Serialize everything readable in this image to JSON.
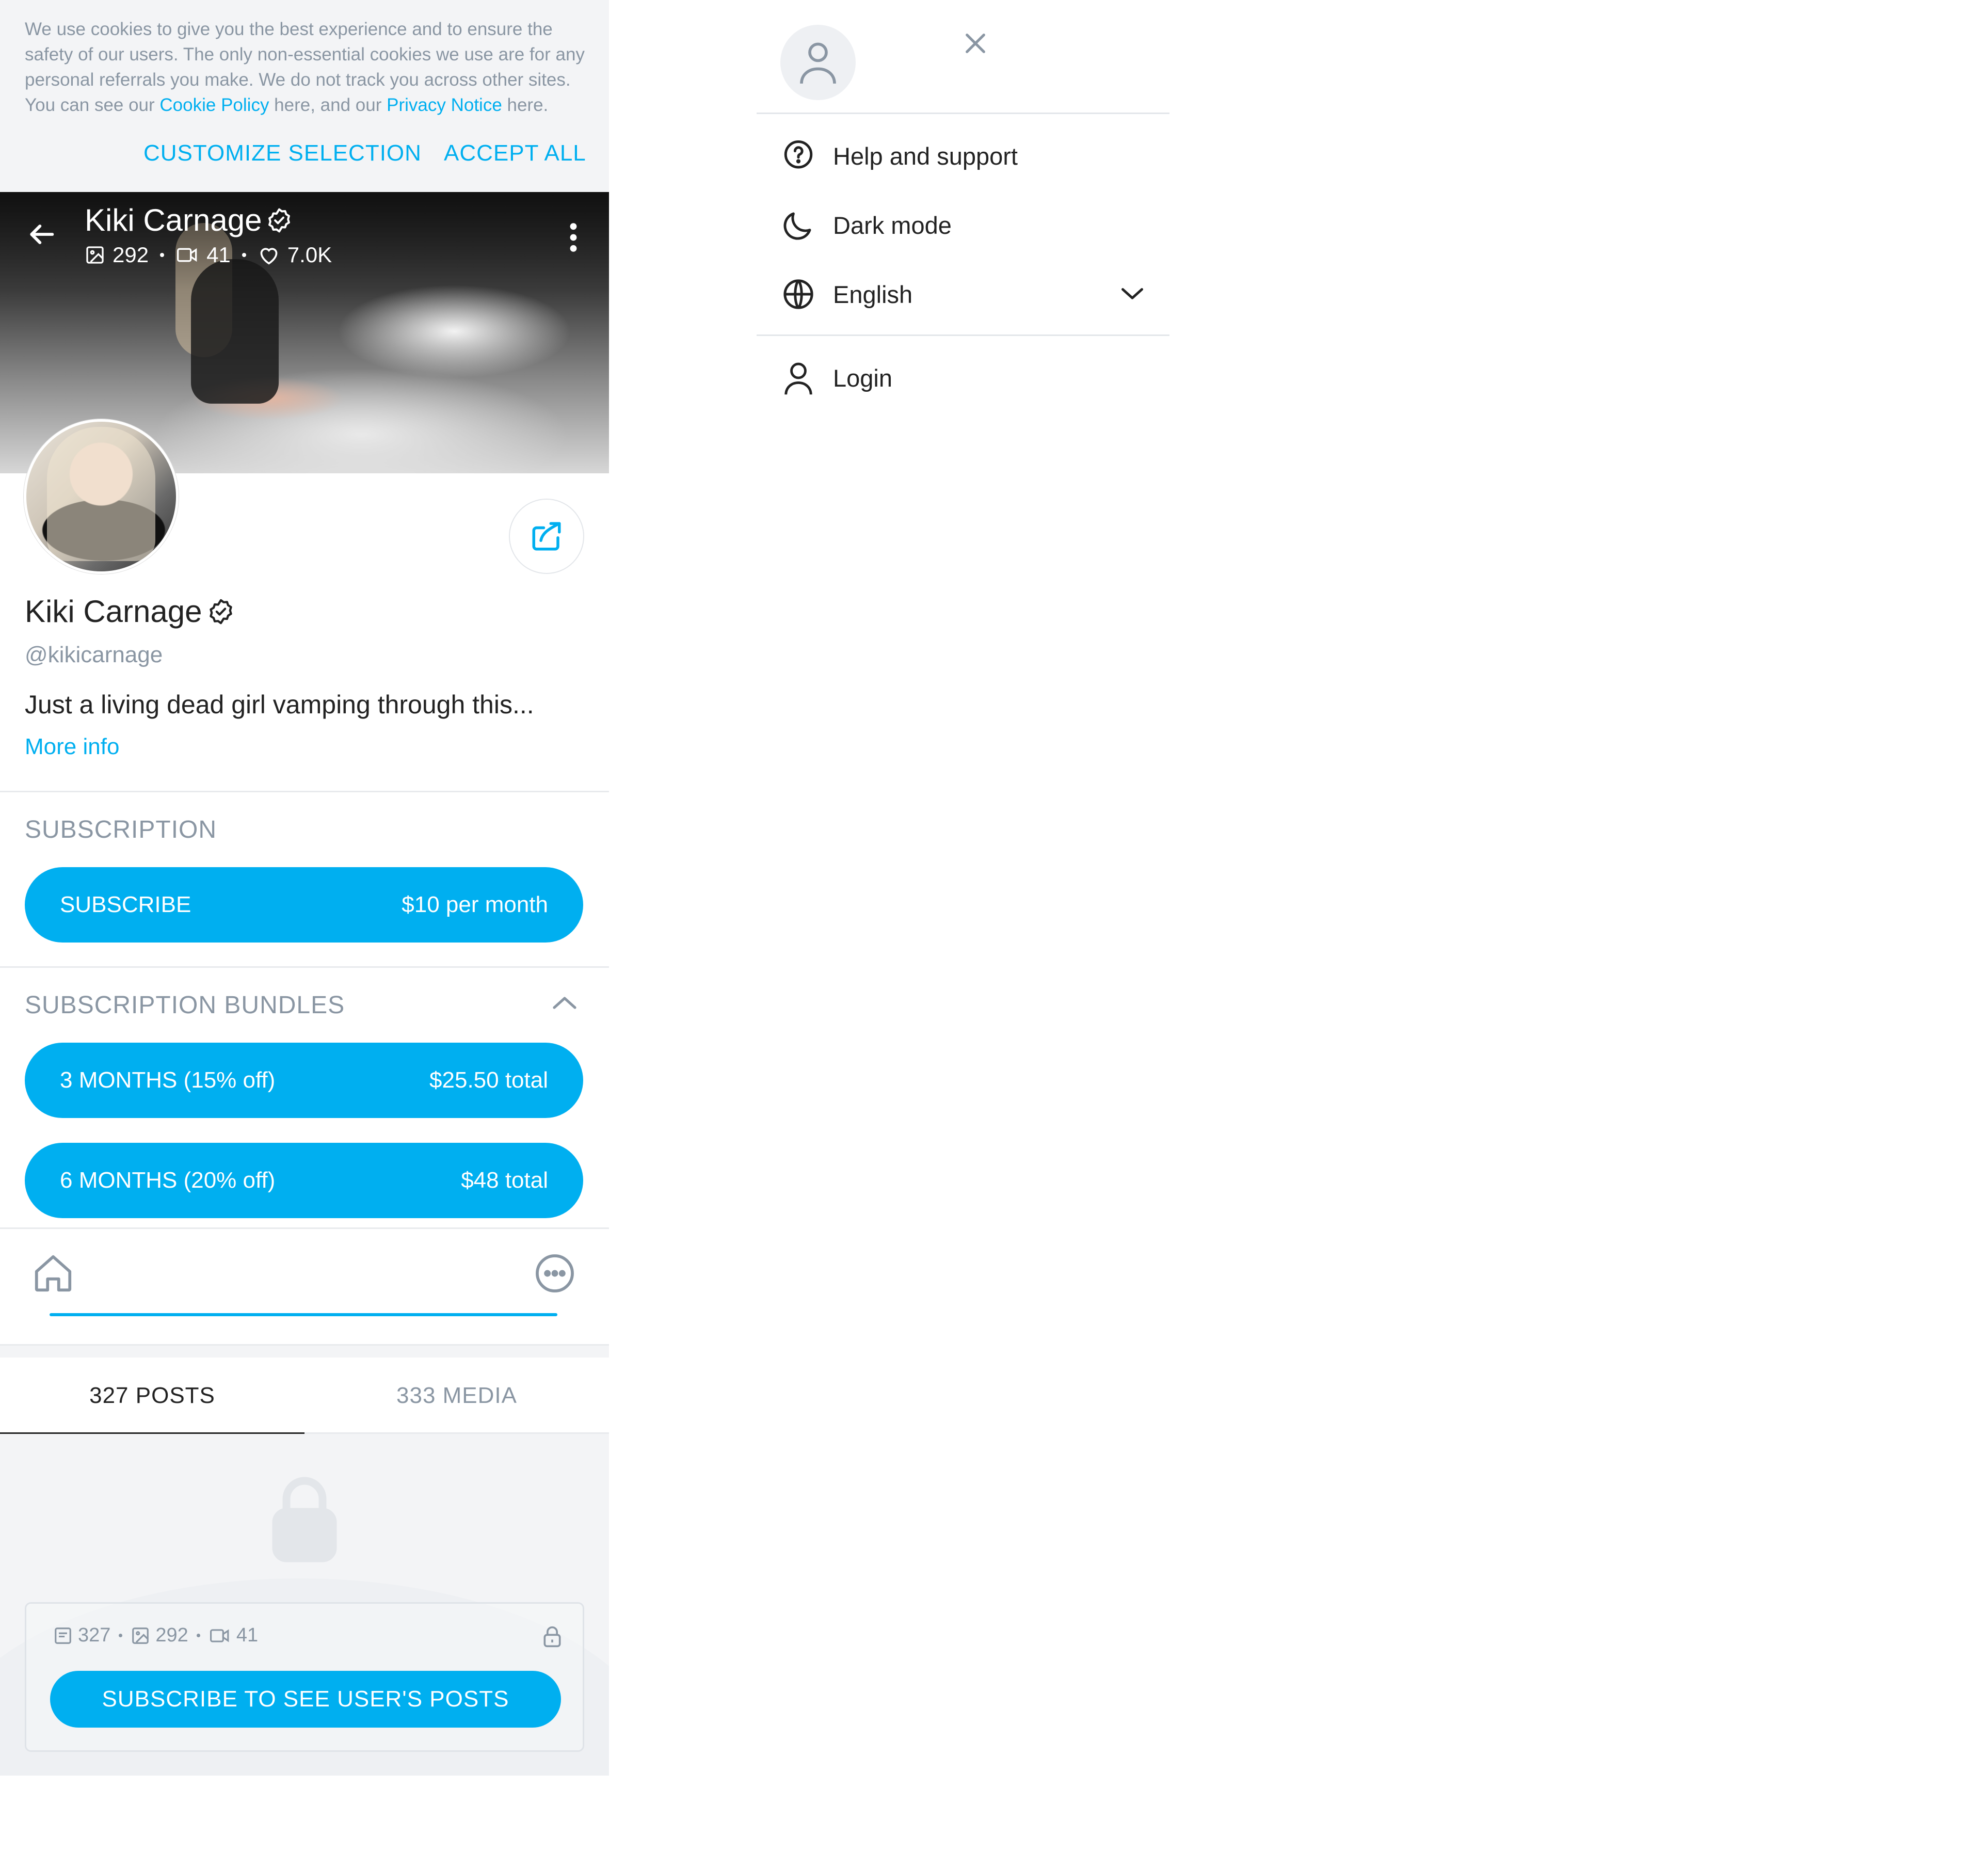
{
  "cookie_banner": {
    "text_part1": "We use cookies to give you the best experience and to ensure the safety of our users. The only non-essential cookies we use are for any personal referrals you make. We do not track you across other sites. You can see our ",
    "cookie_policy_link": "Cookie Policy",
    "text_part2": " here, and our ",
    "privacy_notice_link": "Privacy Notice",
    "text_part3": " here.",
    "customize_label": "CUSTOMIZE SELECTION",
    "accept_label": "ACCEPT ALL"
  },
  "cover": {
    "name": "Kiki Carnage",
    "photos_count": "292",
    "videos_count": "41",
    "likes_count": "7.0K"
  },
  "profile": {
    "name": "Kiki Carnage",
    "handle": "@kikicarnage",
    "bio": "Just a living dead girl vamping through this...",
    "more_info": "More info"
  },
  "subscription": {
    "title": "SUBSCRIPTION",
    "subscribe_label": "SUBSCRIBE",
    "subscribe_price": "$10 per month"
  },
  "bundles": {
    "title": "SUBSCRIPTION BUNDLES",
    "items": [
      {
        "label": "3 MONTHS (15% off)",
        "price": "$25.50 total"
      },
      {
        "label": "6 MONTHS (20% off)",
        "price": "$48 total"
      }
    ]
  },
  "tabs": [
    {
      "label": "327 POSTS",
      "active": true
    },
    {
      "label": "333 MEDIA",
      "active": false
    }
  ],
  "locked": {
    "posts_count": "327",
    "photos_count": "292",
    "videos_count": "41",
    "button_label": "SUBSCRIBE TO SEE USER'S POSTS"
  },
  "menu": {
    "items": [
      {
        "label": "Help and support",
        "icon": "help-icon"
      },
      {
        "label": "Dark mode",
        "icon": "moon-icon"
      },
      {
        "label": "English",
        "icon": "globe-icon"
      },
      {
        "label": "Login",
        "icon": "user-icon"
      }
    ]
  },
  "colors": {
    "accent": "#00aff0",
    "muted_text": "#8a96a3",
    "text": "#222222",
    "panel_bg": "#f3f4f6"
  }
}
